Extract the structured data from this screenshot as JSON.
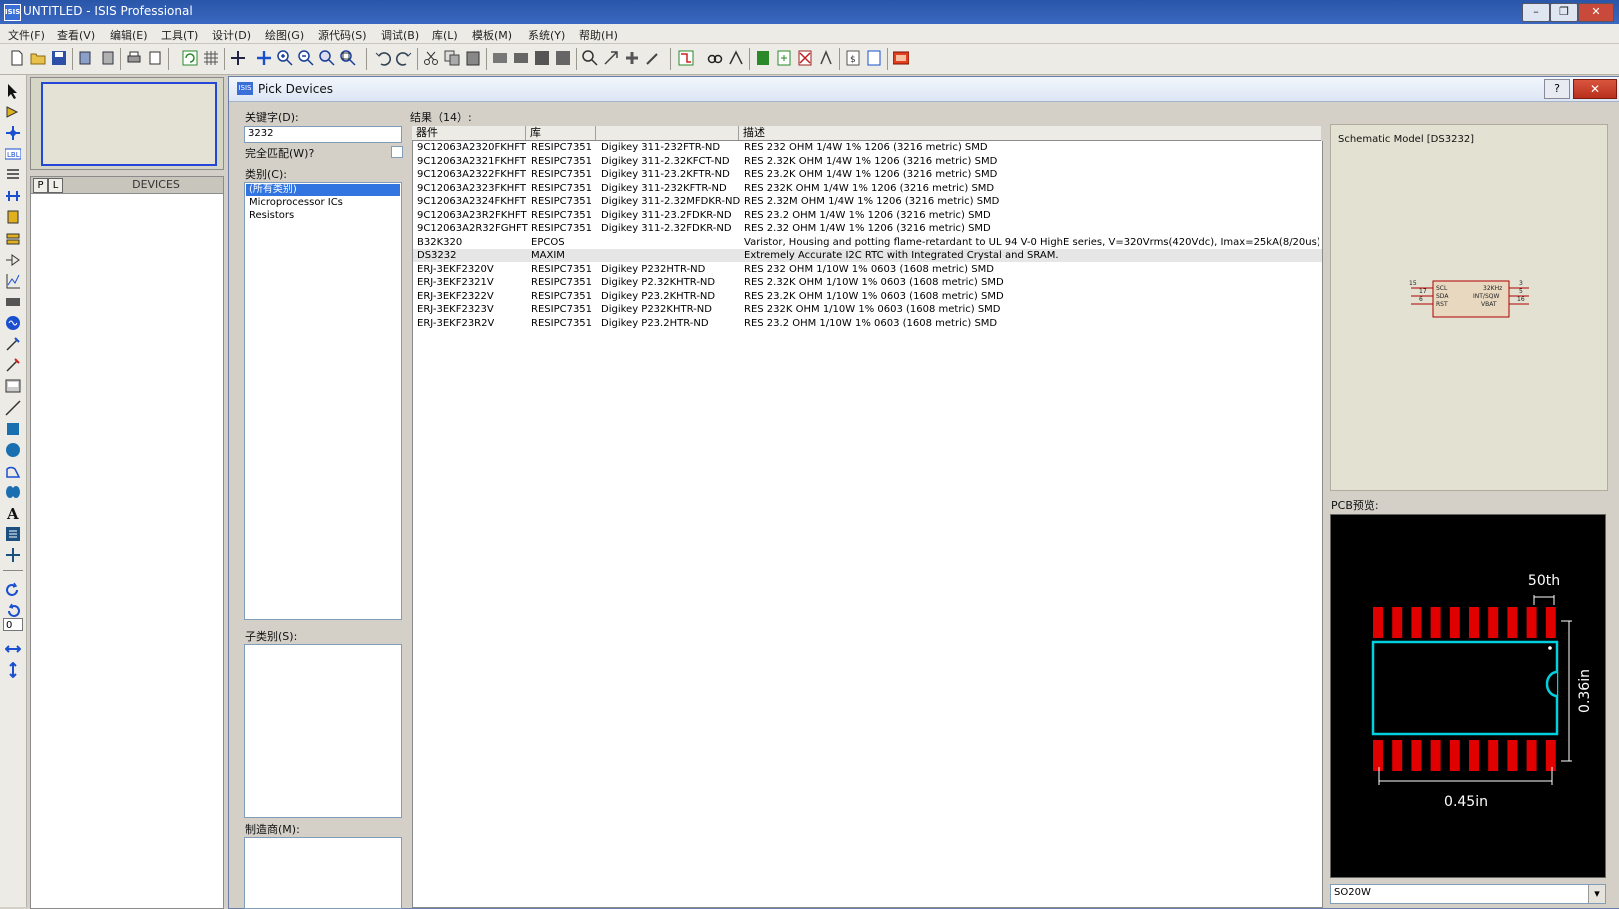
{
  "window": {
    "title": "UNTITLED - ISIS Professional",
    "icon_text": "ISIS",
    "minimize": "–",
    "restore": "❐",
    "close": "✕"
  },
  "menu": [
    "文件(F)",
    "查看(V)",
    "编辑(E)",
    "工具(T)",
    "设计(D)",
    "绘图(G)",
    "源代码(S)",
    "调试(B)",
    "库(L)",
    "模板(M)",
    "系统(Y)",
    "帮助(H)"
  ],
  "left_panel": {
    "p_button": "P",
    "l_button": "L",
    "devices_label": "DEVICES",
    "rotation_value": "0"
  },
  "dialog": {
    "title": "Pick Devices",
    "icon_text": "ISIS",
    "help": "?",
    "close": "✕",
    "keyword_label": "关键字(D):",
    "keyword_value": "3232",
    "match_whole_label": "完全匹配(W)?",
    "category_label": "类别(C):",
    "categories": [
      "(所有类别)",
      "Microprocessor ICs",
      "Resistors"
    ],
    "subcategory_label": "子类别(S):",
    "manufacturer_label": "制造商(M):",
    "results_label": "结果（14）:",
    "columns": [
      "器件",
      "库",
      "",
      "描述"
    ],
    "results": [
      {
        "device": "9C12063A2320FKHFT",
        "lib": "RESIPC7351",
        "part": "Digikey 311-232FTR-ND",
        "desc": "RES 232 OHM 1/4W 1% 1206 (3216 metric) SMD"
      },
      {
        "device": "9C12063A2321FKHFT",
        "lib": "RESIPC7351",
        "part": "Digikey 311-2.32KFCT-ND",
        "desc": "RES 2.32K OHM 1/4W 1% 1206 (3216 metric) SMD"
      },
      {
        "device": "9C12063A2322FKHFT",
        "lib": "RESIPC7351",
        "part": "Digikey 311-23.2KFTR-ND",
        "desc": "RES 23.2K OHM 1/4W 1% 1206 (3216 metric) SMD"
      },
      {
        "device": "9C12063A2323FKHFT",
        "lib": "RESIPC7351",
        "part": "Digikey 311-232KFTR-ND",
        "desc": "RES 232K OHM 1/4W 1% 1206 (3216 metric) SMD"
      },
      {
        "device": "9C12063A2324FKHFT",
        "lib": "RESIPC7351",
        "part": "Digikey 311-2.32MFDKR-ND",
        "desc": "RES 2.32M OHM 1/4W 1% 1206 (3216 metric) SMD"
      },
      {
        "device": "9C12063A23R2FKHFT",
        "lib": "RESIPC7351",
        "part": "Digikey 311-23.2FDKR-ND",
        "desc": "RES 23.2 OHM 1/4W 1% 1206 (3216 metric) SMD"
      },
      {
        "device": "9C12063A2R32FGHFT",
        "lib": "RESIPC7351",
        "part": "Digikey 311-2.32FDKR-ND",
        "desc": "RES 2.32 OHM 1/4W 1% 1206 (3216 metric) SMD"
      },
      {
        "device": "B32K320",
        "lib": "EPCOS",
        "part": "",
        "desc": "Varistor, Housing and potting flame-retardant to UL 94 V-0 HighE series, V=320Vrms(420Vdc), Imax=25kA(8/20us), W=430J, F"
      },
      {
        "device": "DS3232",
        "lib": "MAXIM",
        "part": "",
        "desc": "Extremely Accurate I2C RTC with Integrated Crystal and SRAM."
      },
      {
        "device": "ERJ-3EKF2320V",
        "lib": "RESIPC7351",
        "part": "Digikey P232HTR-ND",
        "desc": "RES 232 OHM 1/10W 1% 0603 (1608 metric) SMD"
      },
      {
        "device": "ERJ-3EKF2321V",
        "lib": "RESIPC7351",
        "part": "Digikey P2.32KHTR-ND",
        "desc": "RES 2.32K OHM 1/10W 1% 0603 (1608 metric) SMD"
      },
      {
        "device": "ERJ-3EKF2322V",
        "lib": "RESIPC7351",
        "part": "Digikey P23.2KHTR-ND",
        "desc": "RES 23.2K OHM 1/10W 1% 0603 (1608 metric) SMD"
      },
      {
        "device": "ERJ-3EKF2323V",
        "lib": "RESIPC7351",
        "part": "Digikey P232KHTR-ND",
        "desc": "RES 232K OHM 1/10W 1% 0603 (1608 metric) SMD"
      },
      {
        "device": "ERJ-3EKF23R2V",
        "lib": "RESIPC7351",
        "part": "Digikey P23.2HTR-ND",
        "desc": "RES 23.2 OHM 1/10W 1% 0603 (1608 metric) SMD"
      }
    ],
    "schematic_label": "Schematic Model [DS3232]",
    "schematic_symbol": {
      "left_pins": [
        "SCL",
        "SDA",
        "RST"
      ],
      "right_pins": [
        "32KHz",
        "INT/SQW",
        "VBAT"
      ],
      "left_nums": [
        "15",
        "17",
        "6"
      ],
      "right_nums": [
        "3",
        "5",
        "16"
      ]
    },
    "pcb_label": "PCB预览:",
    "pcb": {
      "dim_top": "50th",
      "dim_right": "0.36in",
      "dim_bottom": "0.45in"
    },
    "footprint_value": "SO20W",
    "combo_arrow": "▾"
  },
  "colors": {
    "title_bar": "#2a56a8",
    "selection": "#3375e0",
    "pcb_pad": "#e00000",
    "pcb_outline": "#00d0e0"
  }
}
